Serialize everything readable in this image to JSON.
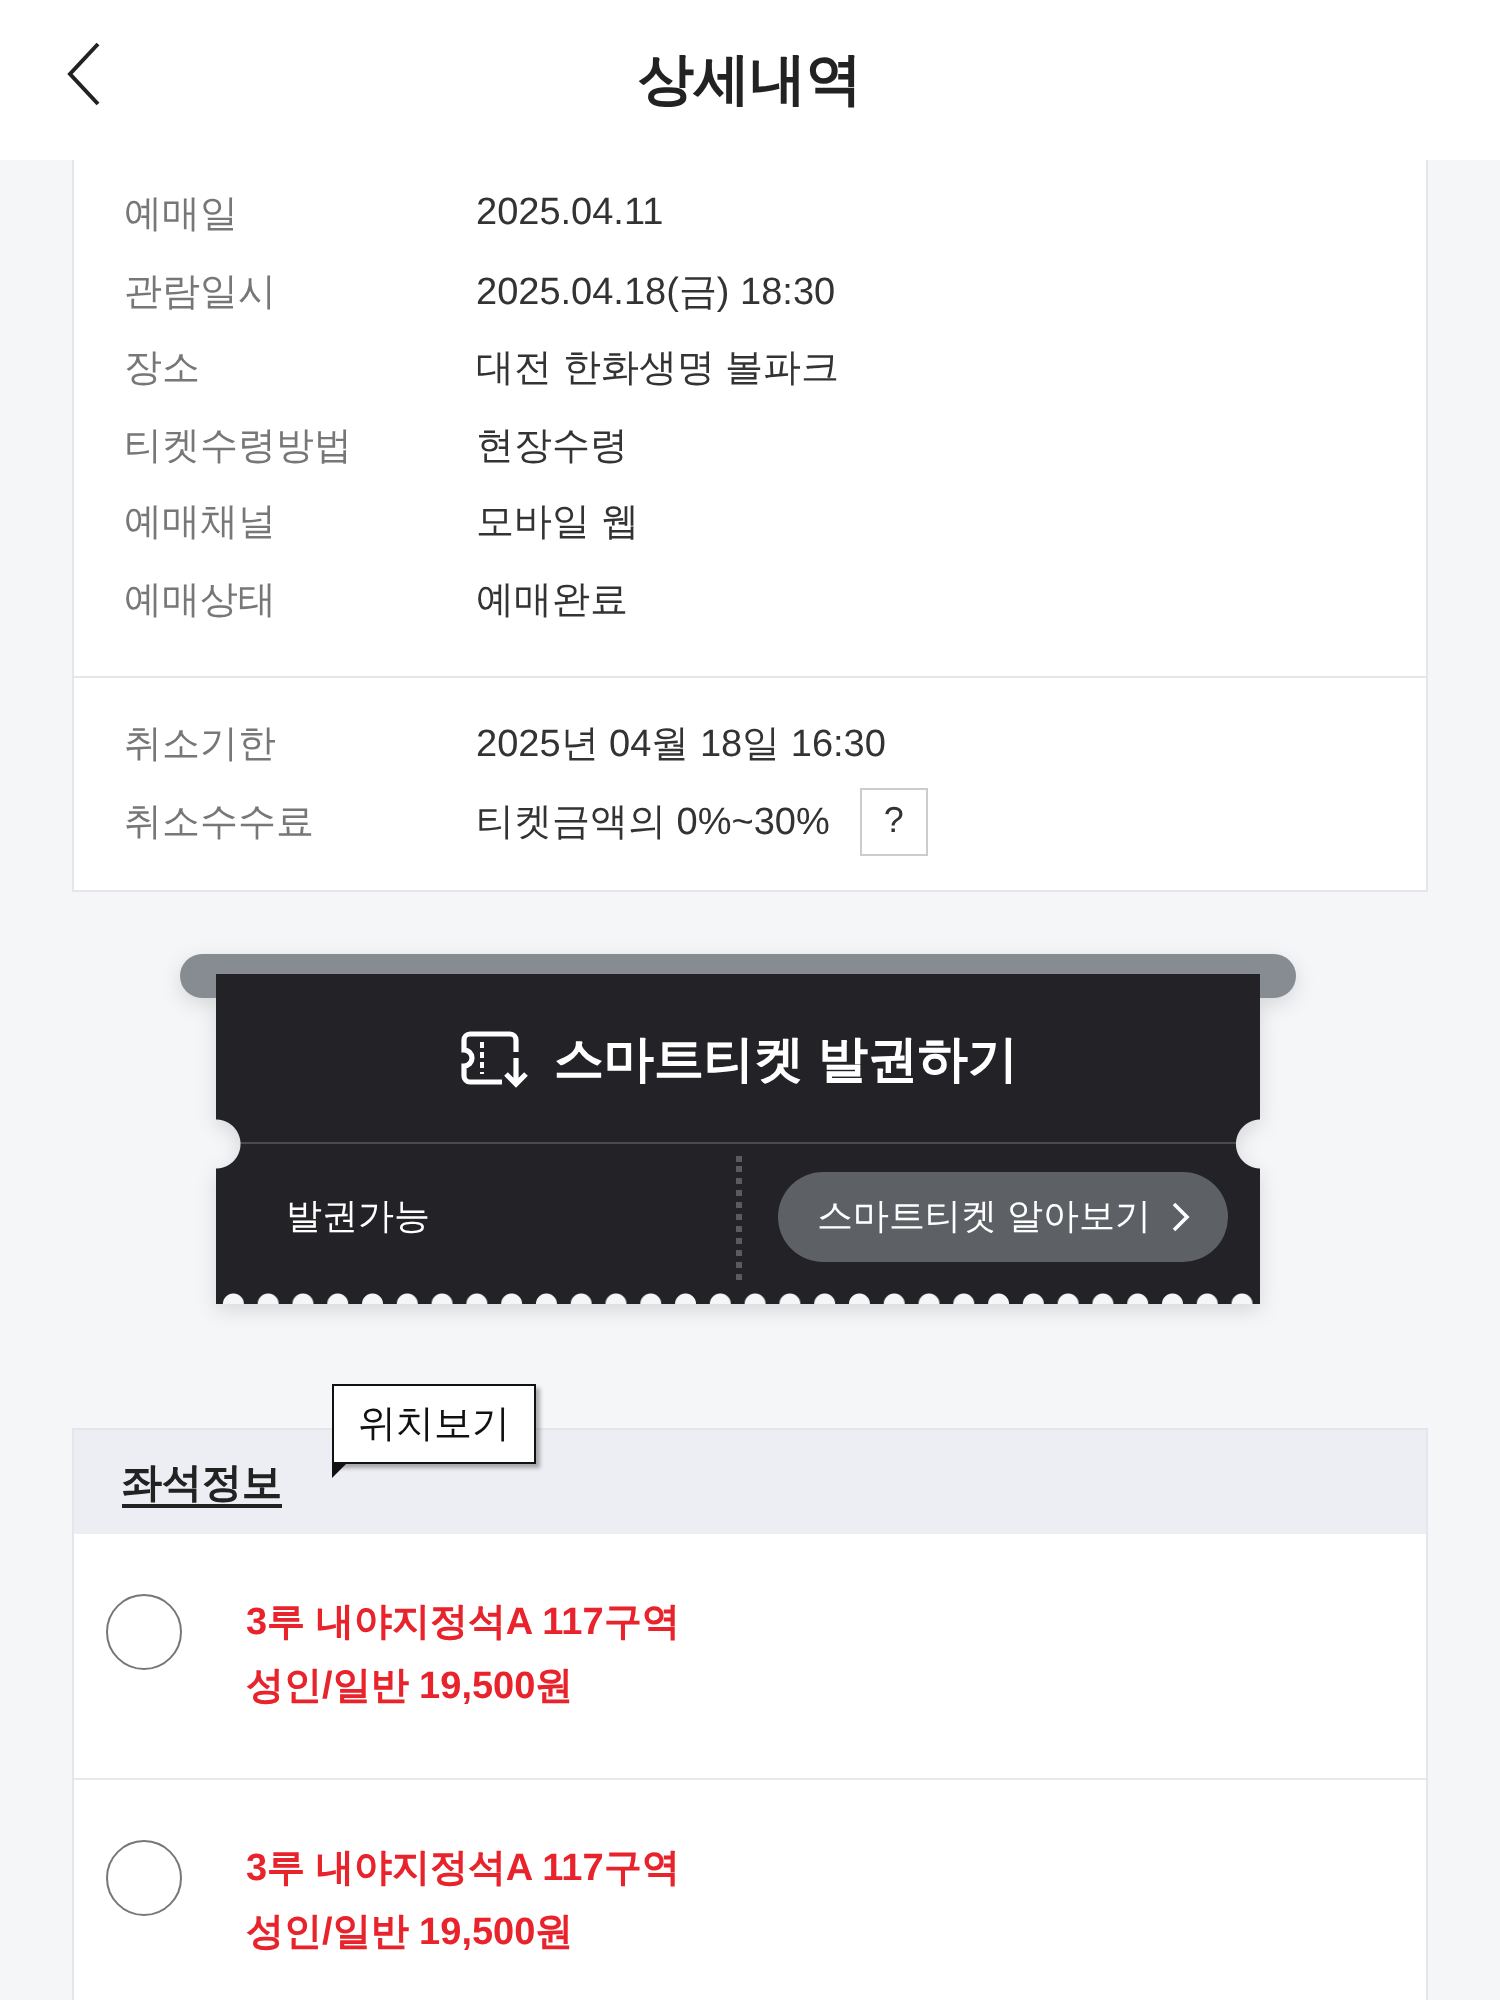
{
  "header": {
    "title": "상세내역"
  },
  "booking_details": [
    {
      "label": "예매일",
      "value": "2025.04.11"
    },
    {
      "label": "관람일시",
      "value": "2025.04.18(금) 18:30"
    },
    {
      "label": "장소",
      "value": "대전 한화생명 볼파크"
    },
    {
      "label": "티켓수령방법",
      "value": "현장수령"
    },
    {
      "label": "예매채널",
      "value": "모바일 웹"
    },
    {
      "label": "예매상태",
      "value": "예매완료"
    }
  ],
  "cancellation": [
    {
      "label": "취소기한",
      "value": "2025년 04월 18일 16:30"
    },
    {
      "label": "취소수수료",
      "value": "티켓금액의 0%~30%",
      "help": "?"
    }
  ],
  "smart_ticket": {
    "title": "스마트티켓 발권하기",
    "status": "발권가능",
    "button": "스마트티켓 알아보기"
  },
  "seat_info": {
    "title": "좌석정보",
    "tooltip": "위치보기",
    "seats": [
      {
        "section": "3루 내야지정석A 117구역",
        "price": "성인/일반 19,500원",
        "selected": false
      },
      {
        "section": "3루 내야지정석A 117구역",
        "price": "성인/일반 19,500원",
        "selected": false
      }
    ]
  }
}
